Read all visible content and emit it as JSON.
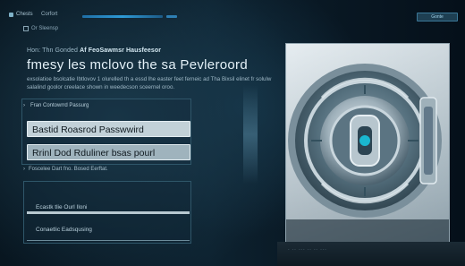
{
  "topbar": {
    "brand": "Chests",
    "nav": [
      "Corfort"
    ],
    "button": "Gonte"
  },
  "breadcrumb": "Or Sleensp",
  "kicker_prefix": "Hon: Thn Gonded",
  "kicker_bold": "Af FeoSawmsr Hausfeesor",
  "title": "fmesy les mclovo the sa Pevleroord",
  "description": "exsolatioe bsolcatie Ibtlovov 1 olurelled th a essd lhe easter feet ferneic ad Tha Bixsil elinet fr solulw salalind goolor creelace shown in weedecson sceernel oroo.",
  "form": {
    "section_label": "Fran Contowrrd Passurg",
    "current_password": "Bastid Roasrod Passwwird",
    "new_password": "Rrinl Dod Rduliner bsas pourl",
    "note": "Foscelee Dart fno. Bosed Eerftat."
  },
  "options": [
    "Ecastk tlie Ourl Iloni",
    "Conaetlic Eadsqusing"
  ],
  "image": {
    "subject": "bank-vault-door",
    "footer_text": "- -- --- -- -- ---"
  },
  "colors": {
    "background": "#0d2230",
    "accent": "#2e9ad6",
    "input_fill": "#c2d1d8"
  }
}
